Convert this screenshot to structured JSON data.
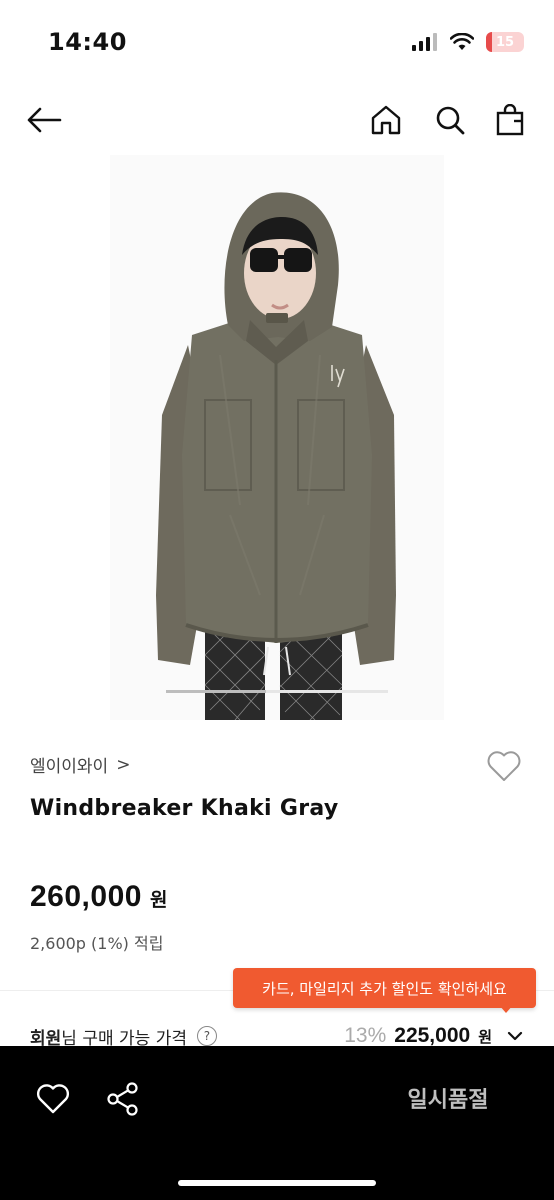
{
  "status_bar": {
    "time": "14:40",
    "battery": "15",
    "battery_level": 0.15
  },
  "nav": {
    "back_icon": "arrow-left-icon",
    "home_icon": "home-icon",
    "search_icon": "search-icon",
    "cart_icon": "shopping-bag-icon"
  },
  "image": {
    "carousel_progress": 0.45
  },
  "product": {
    "brand": "엘이이와이",
    "brand_chevron": ">",
    "name": "Windbreaker Khaki Gray",
    "price": "260,000",
    "price_unit": "원",
    "points": "2,600p (1%) 적립"
  },
  "tooltip": {
    "text": "카드, 마일리지 추가 할인도 확인하세요"
  },
  "member_price": {
    "label_bold": "회원",
    "label_rest": "님 구매 가능 가격",
    "help": "?",
    "discount": "13%",
    "price": "225,000",
    "unit": "원"
  },
  "bottom_bar": {
    "soldout_label": "일시품절",
    "wish_icon": "heart-icon",
    "share_icon": "share-icon"
  },
  "colors": {
    "accent": "#f05a30",
    "bottom_bar": "#000000",
    "soldout_text": "#bfbfbf"
  }
}
